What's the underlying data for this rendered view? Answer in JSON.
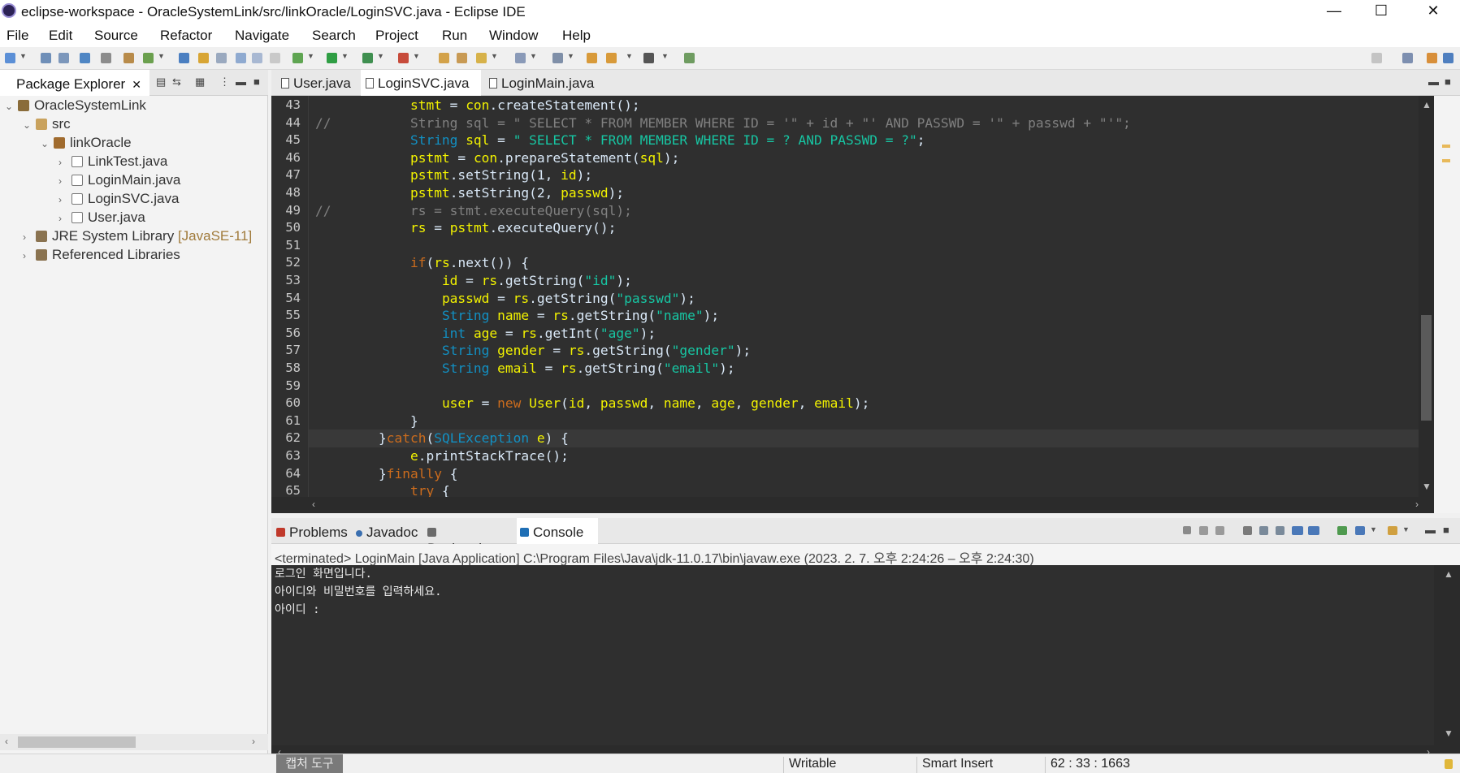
{
  "window": {
    "title": "eclipse-workspace - OracleSystemLink/src/linkOracle/LoginSVC.java - Eclipse IDE",
    "minimize": "—",
    "maximize": "☐",
    "close": "✕"
  },
  "menu": [
    "File",
    "Edit",
    "Source",
    "Refactor",
    "Navigate",
    "Search",
    "Project",
    "Run",
    "Window",
    "Help"
  ],
  "package_explorer": {
    "tab_label": "Package Explorer",
    "close": "✕",
    "tree": [
      {
        "label": "OracleSystemLink",
        "hint": "",
        "icon": "project-icon",
        "chev": "⌄"
      },
      {
        "label": "src",
        "hint": "",
        "icon": "source-folder-icon",
        "chev": "⌄"
      },
      {
        "label": "linkOracle",
        "hint": "",
        "icon": "package-icon",
        "chev": "⌄"
      },
      {
        "label": "LinkTest.java",
        "hint": "",
        "icon": "java-file-icon",
        "chev": "›"
      },
      {
        "label": "LoginMain.java",
        "hint": "",
        "icon": "java-file-icon",
        "chev": "›"
      },
      {
        "label": "LoginSVC.java",
        "hint": "",
        "icon": "java-file-icon",
        "chev": "›"
      },
      {
        "label": "User.java",
        "hint": "",
        "icon": "java-file-icon",
        "chev": "›"
      },
      {
        "label": "JRE System Library ",
        "hint": "[JavaSE-11]",
        "icon": "library-icon",
        "chev": "›"
      },
      {
        "label": "Referenced Libraries",
        "hint": "",
        "icon": "library-icon",
        "chev": "›"
      }
    ]
  },
  "editor": {
    "tabs": [
      {
        "label": "User.java",
        "close": ""
      },
      {
        "label": "LoginSVC.java",
        "close": "✕"
      },
      {
        "label": "LoginMain.java",
        "close": ""
      }
    ],
    "lines": [
      {
        "n": "43",
        "code": [
          [
            "pl",
            "            "
          ],
          [
            "va",
            "stmt"
          ],
          [
            "pl",
            " = "
          ],
          [
            "va",
            "con"
          ],
          [
            "pl",
            ".createStatement();"
          ]
        ]
      },
      {
        "n": "44",
        "code": [
          [
            "cm",
            "//          String sql = \" SELECT * FROM MEMBER WHERE ID = '\" + id + \"' AND PASSWD = '\" + passwd + \"'\";"
          ]
        ]
      },
      {
        "n": "45",
        "code": [
          [
            "pl",
            "            "
          ],
          [
            "ty",
            "String"
          ],
          [
            "pl",
            " "
          ],
          [
            "va",
            "sql"
          ],
          [
            "pl",
            " = "
          ],
          [
            "st",
            "\" SELECT * FROM MEMBER WHERE ID = ? AND PASSWD = ?\""
          ],
          [
            "pl",
            ";"
          ]
        ]
      },
      {
        "n": "46",
        "code": [
          [
            "pl",
            "            "
          ],
          [
            "va",
            "pstmt"
          ],
          [
            "pl",
            " = "
          ],
          [
            "va",
            "con"
          ],
          [
            "pl",
            ".prepareStatement("
          ],
          [
            "va",
            "sql"
          ],
          [
            "pl",
            ");"
          ]
        ]
      },
      {
        "n": "47",
        "code": [
          [
            "pl",
            "            "
          ],
          [
            "va",
            "pstmt"
          ],
          [
            "pl",
            ".setString(1, "
          ],
          [
            "va",
            "id"
          ],
          [
            "pl",
            ");"
          ]
        ]
      },
      {
        "n": "48",
        "code": [
          [
            "pl",
            "            "
          ],
          [
            "va",
            "pstmt"
          ],
          [
            "pl",
            ".setString(2, "
          ],
          [
            "va",
            "passwd"
          ],
          [
            "pl",
            ");"
          ]
        ]
      },
      {
        "n": "49",
        "code": [
          [
            "cm",
            "//          rs = stmt.executeQuery(sql);"
          ]
        ]
      },
      {
        "n": "50",
        "code": [
          [
            "pl",
            "            "
          ],
          [
            "va",
            "rs"
          ],
          [
            "pl",
            " = "
          ],
          [
            "va",
            "pstmt"
          ],
          [
            "pl",
            ".executeQuery();"
          ]
        ]
      },
      {
        "n": "51",
        "code": [
          [
            "pl",
            " "
          ]
        ]
      },
      {
        "n": "52",
        "code": [
          [
            "pl",
            "            "
          ],
          [
            "kw",
            "if"
          ],
          [
            "pl",
            "("
          ],
          [
            "va",
            "rs"
          ],
          [
            "pl",
            ".next()) {"
          ]
        ]
      },
      {
        "n": "53",
        "code": [
          [
            "pl",
            "                "
          ],
          [
            "va",
            "id"
          ],
          [
            "pl",
            " = "
          ],
          [
            "va",
            "rs"
          ],
          [
            "pl",
            ".getString("
          ],
          [
            "st",
            "\"id\""
          ],
          [
            "pl",
            ");"
          ]
        ]
      },
      {
        "n": "54",
        "code": [
          [
            "pl",
            "                "
          ],
          [
            "va",
            "passwd"
          ],
          [
            "pl",
            " = "
          ],
          [
            "va",
            "rs"
          ],
          [
            "pl",
            ".getString("
          ],
          [
            "st",
            "\"passwd\""
          ],
          [
            "pl",
            ");"
          ]
        ]
      },
      {
        "n": "55",
        "code": [
          [
            "pl",
            "                "
          ],
          [
            "ty",
            "String"
          ],
          [
            "pl",
            " "
          ],
          [
            "va",
            "name"
          ],
          [
            "pl",
            " = "
          ],
          [
            "va",
            "rs"
          ],
          [
            "pl",
            ".getString("
          ],
          [
            "st",
            "\"name\""
          ],
          [
            "pl",
            ");"
          ]
        ]
      },
      {
        "n": "56",
        "code": [
          [
            "pl",
            "                "
          ],
          [
            "ty",
            "int"
          ],
          [
            "pl",
            " "
          ],
          [
            "va",
            "age"
          ],
          [
            "pl",
            " = "
          ],
          [
            "va",
            "rs"
          ],
          [
            "pl",
            ".getInt("
          ],
          [
            "st",
            "\"age\""
          ],
          [
            "pl",
            ");"
          ]
        ]
      },
      {
        "n": "57",
        "code": [
          [
            "pl",
            "                "
          ],
          [
            "ty",
            "String"
          ],
          [
            "pl",
            " "
          ],
          [
            "va",
            "gender"
          ],
          [
            "pl",
            " = "
          ],
          [
            "va",
            "rs"
          ],
          [
            "pl",
            ".getString("
          ],
          [
            "st",
            "\"gender\""
          ],
          [
            "pl",
            ");"
          ]
        ]
      },
      {
        "n": "58",
        "code": [
          [
            "pl",
            "                "
          ],
          [
            "ty",
            "String"
          ],
          [
            "pl",
            " "
          ],
          [
            "va",
            "email"
          ],
          [
            "pl",
            " = "
          ],
          [
            "va",
            "rs"
          ],
          [
            "pl",
            ".getString("
          ],
          [
            "st",
            "\"email\""
          ],
          [
            "pl",
            ");"
          ]
        ]
      },
      {
        "n": "59",
        "code": [
          [
            "pl",
            " "
          ]
        ]
      },
      {
        "n": "60",
        "code": [
          [
            "pl",
            "                "
          ],
          [
            "va",
            "user"
          ],
          [
            "pl",
            " = "
          ],
          [
            "kw",
            "new"
          ],
          [
            "pl",
            " "
          ],
          [
            "va",
            "User"
          ],
          [
            "pl",
            "("
          ],
          [
            "va",
            "id"
          ],
          [
            "pl",
            ", "
          ],
          [
            "va",
            "passwd"
          ],
          [
            "pl",
            ", "
          ],
          [
            "va",
            "name"
          ],
          [
            "pl",
            ", "
          ],
          [
            "va",
            "age"
          ],
          [
            "pl",
            ", "
          ],
          [
            "va",
            "gender"
          ],
          [
            "pl",
            ", "
          ],
          [
            "va",
            "email"
          ],
          [
            "pl",
            ");"
          ]
        ]
      },
      {
        "n": "61",
        "code": [
          [
            "pl",
            "            }"
          ]
        ]
      },
      {
        "n": "62",
        "code": [
          [
            "pl",
            "        }"
          ],
          [
            "kw",
            "catch"
          ],
          [
            "pl",
            "("
          ],
          [
            "ty",
            "SQLException"
          ],
          [
            "pl",
            " "
          ],
          [
            "va",
            "e"
          ],
          [
            "pl",
            ") {"
          ]
        ]
      },
      {
        "n": "63",
        "code": [
          [
            "pl",
            "            "
          ],
          [
            "va",
            "e"
          ],
          [
            "pl",
            ".printStackTrace();"
          ]
        ]
      },
      {
        "n": "64",
        "code": [
          [
            "pl",
            "        }"
          ],
          [
            "kw",
            "finally"
          ],
          [
            "pl",
            " {"
          ]
        ]
      },
      {
        "n": "65",
        "code": [
          [
            "pl",
            "            "
          ],
          [
            "kw",
            "try"
          ],
          [
            "pl",
            " {"
          ]
        ]
      }
    ],
    "current_line": "62"
  },
  "bottom_panel": {
    "tabs": [
      {
        "label": "Problems",
        "close": ""
      },
      {
        "label": "Javadoc",
        "close": ""
      },
      {
        "label": "Declaration",
        "close": ""
      },
      {
        "label": "Console",
        "close": "✕"
      }
    ],
    "status": "<terminated> LoginMain [Java Application] C:\\Program Files\\Java\\jdk-11.0.17\\bin\\javaw.exe  (2023. 2. 7. 오후 2:24:26 – 오후 2:24:30)",
    "output": [
      "로그인 화면입니다.",
      "아이디와 비밀번호를 입력하세요.",
      "아이디 :"
    ]
  },
  "statusbar": {
    "snip": "캡처 도구",
    "writable": "Writable",
    "insert_mode": "Smart Insert",
    "position": "62 : 33 : 1663"
  },
  "colors": {
    "editor_bg": "#2f2f2f",
    "keyword": "#cc6c1d",
    "type": "#1290c3",
    "string": "#17c6a3",
    "variable": "#f2f200",
    "comment": "#808080"
  }
}
